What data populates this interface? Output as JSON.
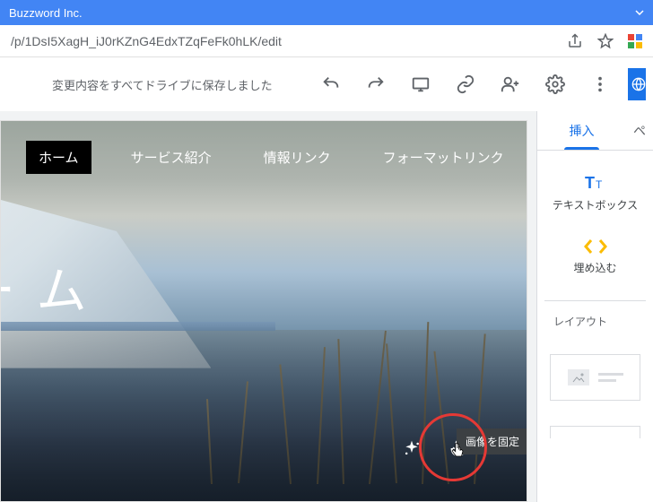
{
  "titleBar": {
    "text": "Buzzword Inc."
  },
  "url": "/p/1DsI5XagH_iJ0rKZnG4EdxTZqFeFk0hLK/edit",
  "toolbar": {
    "saveStatus": "変更内容をすべてドライブに保存しました"
  },
  "page": {
    "nav": [
      {
        "label": "ホーム",
        "active": true
      },
      {
        "label": "サービス紹介",
        "active": false
      },
      {
        "label": "情報リンク",
        "active": false
      },
      {
        "label": "フォーマットリンク",
        "active": false
      }
    ],
    "heading": "ー ム",
    "tooltip": "画像を固定"
  },
  "panel": {
    "tabs": {
      "insert": "挿入",
      "pagesPartial": "ペ"
    },
    "textBox": "テキストボックス",
    "embed": "埋め込む",
    "layout": "レイアウト"
  }
}
